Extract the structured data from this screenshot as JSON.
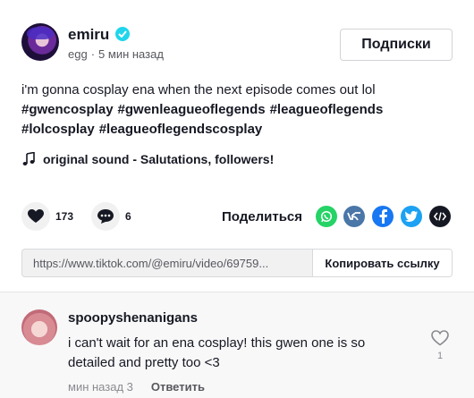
{
  "post": {
    "author": {
      "username": "emiru",
      "nickname": "egg",
      "time_ago": "5 мин назад",
      "verified": true
    },
    "follow_label": "Подписки",
    "caption_text": "i'm gonna cosplay ena when the next episode comes out lol",
    "hashtags": [
      "#gwencosplay",
      "#gwenleagueoflegends",
      "#leagueoflegends",
      "#lolcosplay",
      "#leagueoflegendscosplay"
    ],
    "sound_label": "original sound - Salutations, followers!",
    "sound_icon": "music-note-icon",
    "likes": "173",
    "comments_count": "6",
    "share_label": "Поделиться",
    "share_targets": [
      {
        "name": "whatsapp",
        "color": "#25d366"
      },
      {
        "name": "vk",
        "color": "#4a76a8"
      },
      {
        "name": "facebook",
        "color": "#1877f2"
      },
      {
        "name": "twitter",
        "color": "#1da1f2"
      },
      {
        "name": "embed",
        "color": "#161823"
      }
    ],
    "link_url": "https://www.tiktok.com/@emiru/video/69759...",
    "copy_label": "Копировать ссылку"
  },
  "comments": [
    {
      "username": "spoopyshenanigans",
      "text": "i can't wait for an ena cosplay! this gwen one is so detailed and pretty too <3",
      "time": "мин назад 3",
      "reply_label": "Ответить",
      "likes": "1"
    }
  ]
}
